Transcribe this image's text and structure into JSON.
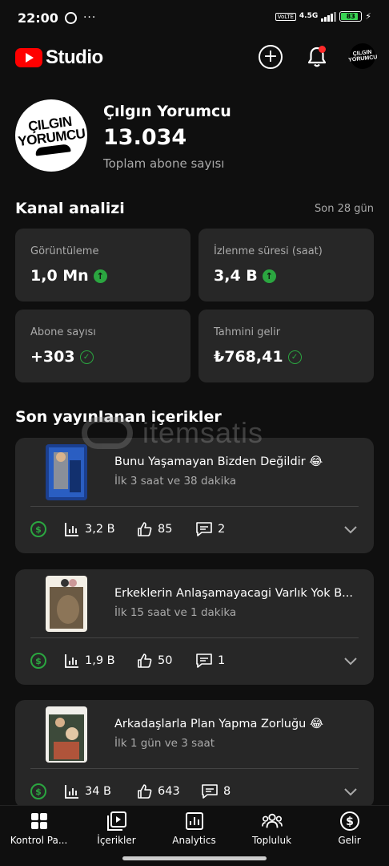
{
  "status_bar": {
    "time": "22:00",
    "network": "4.5G",
    "volte": "VoLTE",
    "battery": "83"
  },
  "header": {
    "logo_text": "Studio",
    "avatar_text_line1": "ÇILGIN",
    "avatar_text_line2": "YORUMCU"
  },
  "channel": {
    "avatar_line1": "ÇILGIN",
    "avatar_line2": "YORUMCU",
    "name": "Çılgın Yorumcu",
    "subscribers": "13.034",
    "subscribers_label": "Toplam abone sayısı"
  },
  "analytics": {
    "title": "Kanal analizi",
    "period": "Son 28 gün",
    "cards": [
      {
        "label": "Görüntüleme",
        "value": "1,0 Mn",
        "trend": "up"
      },
      {
        "label": "İzlenme süresi (saat)",
        "value": "3,4 B",
        "trend": "up"
      },
      {
        "label": "Abone sayısı",
        "value": "+303",
        "trend": "check"
      },
      {
        "label": "Tahmini gelir",
        "value": "₺768,41",
        "trend": "check"
      }
    ]
  },
  "recent": {
    "title": "Son yayınlanan içerikler",
    "items": [
      {
        "title": "Bunu Yaşamayan Bizden Değildir 😂",
        "subtitle": "İlk 3 saat ve 38 dakika",
        "views": "3,2 B",
        "likes": "85",
        "comments": "2"
      },
      {
        "title": "Erkeklerin Anlaşamayacagi Varlık Yok B...",
        "subtitle": "İlk 15 saat ve 1 dakika",
        "views": "1,9 B",
        "likes": "50",
        "comments": "1"
      },
      {
        "title": "Arkadaşlarla Plan Yapma Zorluğu 😂",
        "subtitle": "İlk 1 gün ve 3 saat",
        "views": "34 B",
        "likes": "643",
        "comments": "8"
      }
    ]
  },
  "watermark": "itemsatis",
  "nav": [
    {
      "label": "Kontrol Pa..."
    },
    {
      "label": "İçerikler"
    },
    {
      "label": "Analytics"
    },
    {
      "label": "Topluluk"
    },
    {
      "label": "Gelir"
    }
  ],
  "colors": {
    "background": "#0f0f0f",
    "card": "#272727",
    "accent_red": "#ff0000",
    "positive_green": "#2ba640"
  }
}
